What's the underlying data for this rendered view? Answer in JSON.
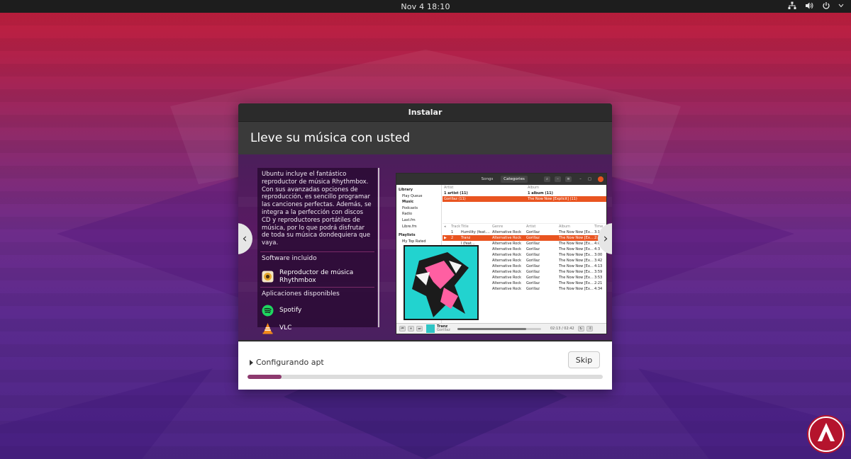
{
  "topbar": {
    "clock": "Nov 4  18:10"
  },
  "window": {
    "title": "Instalar",
    "headline": "Lleve su música con usted"
  },
  "slide": {
    "description": "Ubuntu incluye el fantástico reproductor de música Rhythmbox. Con sus avanzadas opciones de reproducción, es sencillo programar las canciones perfectas. Además, se integra a la perfección con discos CD y reproductores portátiles de música, por lo que podrá disfrutar de toda su música dondequiera que vaya.",
    "included_title": "Software incluido",
    "included_apps": [
      {
        "name": "Reproductor de música Rhythmbox",
        "icon": "rhythmbox-icon"
      }
    ],
    "available_title": "Aplicaciones disponibles",
    "available_apps": [
      {
        "name": "Spotify",
        "icon": "spotify-icon"
      },
      {
        "name": "VLC",
        "icon": "vlc-icon"
      }
    ],
    "prev": "‹",
    "next": "›"
  },
  "rhythmbox": {
    "tabs": {
      "songs": "Songs",
      "categories": "Categories"
    },
    "sidebar": {
      "library": "Library",
      "items": [
        "Play Queue",
        "Music",
        "Podcasts",
        "Radio",
        "Last.fm",
        "Libre.fm"
      ],
      "playlists": "Playlists",
      "playlist_items": [
        "My Top Rated"
      ]
    },
    "browser": {
      "artist_header": "Artist",
      "album_header": "Album",
      "artist_all": "1 artist (11)",
      "album_all": "1 album (11)",
      "artist_sel": "Gorillaz (11)",
      "album_sel": "The Now Now [Explicit] (11)"
    },
    "tracks": {
      "headers": [
        "Track",
        "Title",
        "Genre",
        "Artist",
        "Album",
        "Time"
      ],
      "rows": [
        [
          "1",
          "Humility (feat.…",
          "Alternative Rock",
          "Gorillaz",
          "The Now Now [Ex…",
          "3:18"
        ],
        [
          "2",
          "Tranz",
          "Alternative Rock",
          "Gorillaz",
          "The Now Now [Ex…",
          "2:42"
        ],
        [
          "",
          "l (feat…",
          "Alternative Rock",
          "Gorillaz",
          "The Now Now [Ex…",
          "4:0"
        ],
        [
          "",
          "",
          "Alternative Rock",
          "Gorillaz",
          "The Now Now [Ex…",
          "4:3"
        ],
        [
          "",
          "",
          "Alternative Rock",
          "Gorillaz",
          "The Now Now [Ex…",
          "3:00"
        ],
        [
          "",
          "",
          "Alternative Rock",
          "Gorillaz",
          "The Now Now [Ex…",
          "3:42"
        ],
        [
          "",
          "",
          "Alternative Rock",
          "Gorillaz",
          "The Now Now [Ex…",
          "4:13"
        ],
        [
          "",
          "",
          "Alternative Rock",
          "Gorillaz",
          "The Now Now [Ex…",
          "3:59"
        ],
        [
          "",
          "",
          "Alternative Rock",
          "Gorillaz",
          "The Now Now [Ex…",
          "3:53"
        ],
        [
          "",
          "nt",
          "Alternative Rock",
          "Gorillaz",
          "The Now Now [Ex…",
          "2:21"
        ],
        [
          "",
          "",
          "Alternative Rock",
          "Gorillaz",
          "The Now Now [Ex…",
          "4:34"
        ]
      ]
    },
    "player": {
      "title": "Tranz",
      "artist": "Gorillaz",
      "time": "02:13 / 02:42",
      "position": 0.82
    }
  },
  "install": {
    "status": "Configurando apt",
    "skip_label": "Skip",
    "progress": 0.095
  },
  "colors": {
    "accent": "#e95420",
    "progress": "#8d3a6e",
    "slide_bg": "#581a62"
  }
}
